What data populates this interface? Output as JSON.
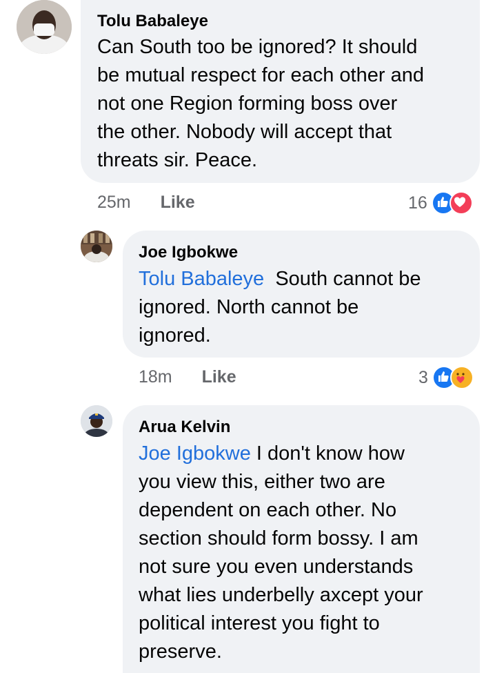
{
  "comments": [
    {
      "author": "Tolu Babaleye",
      "lines": [
        "Can South too be ignored? It should",
        "be mutual respect for each other and",
        "not one Region forming boss over",
        "the other. Nobody will accept that",
        "threats sir. Peace."
      ],
      "time": "25m",
      "like_label": "Like",
      "reaction_count": "16",
      "reactions": [
        "like-icon",
        "love-icon"
      ]
    }
  ],
  "replies": [
    {
      "author": "Joe Igbokwe",
      "mention": "Tolu Babaleye",
      "first_line_rest": "South cannot be",
      "lines": [
        "ignored. North cannot be",
        "ignored."
      ],
      "time": "18m",
      "like_label": "Like",
      "reaction_count": "3",
      "reactions": [
        "like-icon",
        "care-icon"
      ]
    },
    {
      "author": "Arua Kelvin",
      "mention": "Joe Igbokwe",
      "first_line_rest": "I don't know how",
      "lines": [
        "you view this, either two are",
        "dependent on each other. No",
        "section should form bossy. I am",
        "not sure you even understands",
        "what lies underbelly axcept your",
        "political interest you fight to",
        "preserve."
      ]
    }
  ],
  "colors": {
    "bubble": "#f0f2f5",
    "mention": "#216fdb",
    "meta": "#65676b",
    "like_blue": "#1877f2",
    "love_red": "#f33e58",
    "care_yellow": "#f7b125"
  }
}
